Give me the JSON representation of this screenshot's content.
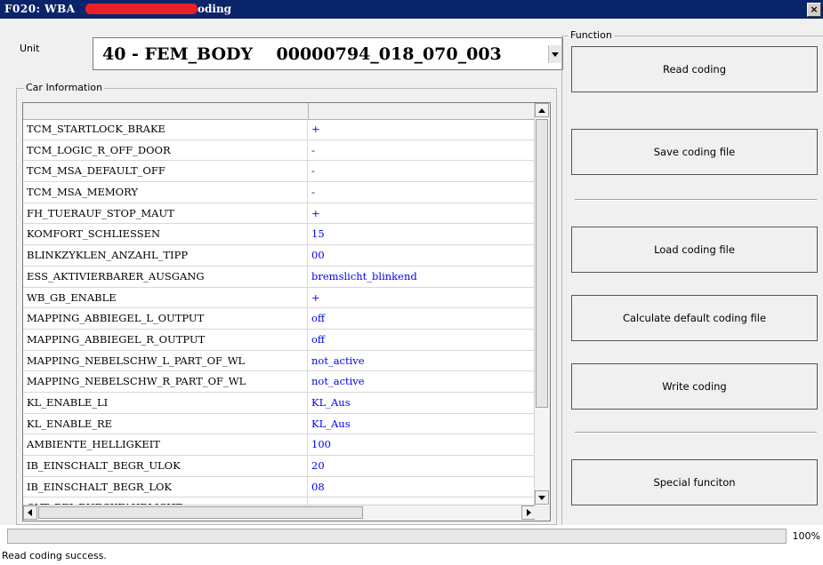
{
  "window": {
    "title_prefix": "F020: WBA",
    "title_suffix": "oding",
    "close_label": "×"
  },
  "unit": {
    "label": "Unit",
    "value": "40 - FEM_BODY    00000794_018_070_003"
  },
  "car_info": {
    "legend": "Car Information",
    "rows": [
      {
        "name": "TCM_STARTLOCK_BRAKE",
        "value": "+"
      },
      {
        "name": "TCM_LOGIC_R_OFF_DOOR",
        "value": "-"
      },
      {
        "name": "TCM_MSA_DEFAULT_OFF",
        "value": "-"
      },
      {
        "name": "TCM_MSA_MEMORY",
        "value": "-"
      },
      {
        "name": "FH_TUERAUF_STOP_MAUT",
        "value": "+"
      },
      {
        "name": "KOMFORT_SCHLIESSEN",
        "value": "15"
      },
      {
        "name": "BLINKZYKLEN_ANZAHL_TIPP",
        "value": "00"
      },
      {
        "name": "ESS_AKTIVIERBARER_AUSGANG",
        "value": "bremslicht_blinkend"
      },
      {
        "name": "WB_GB_ENABLE",
        "value": "+"
      },
      {
        "name": "MAPPING_ABBIEGEL_L_OUTPUT",
        "value": "off"
      },
      {
        "name": "MAPPING_ABBIEGEL_R_OUTPUT",
        "value": "off"
      },
      {
        "name": "MAPPING_NEBELSCHW_L_PART_OF_WL",
        "value": "not_active"
      },
      {
        "name": "MAPPING_NEBELSCHW_R_PART_OF_WL",
        "value": "not_active"
      },
      {
        "name": "KL_ENABLE_LI",
        "value": "KL_Aus"
      },
      {
        "name": "KL_ENABLE_RE",
        "value": "KL_Aus"
      },
      {
        "name": "AMBIENTE_HELLIGKEIT",
        "value": "100"
      },
      {
        "name": "IB_EINSCHALT_BEGR_ULOK",
        "value": "20"
      },
      {
        "name": "IB_EINSCHALT_BEGR_LOK",
        "value": "08"
      },
      {
        "name": "OVT_BEI_RUECKFAHRLICHT",
        "value": "-"
      }
    ]
  },
  "function": {
    "legend": "Function",
    "buttons": {
      "read": "Read coding",
      "save": "Save coding file",
      "load": "Load coding file",
      "calculate": "Calculate default coding file",
      "write": "Write coding",
      "special": "Special funciton"
    }
  },
  "progress": {
    "value": 100,
    "label": "100%"
  },
  "status": {
    "text": "Read coding success."
  },
  "colors": {
    "titlebar": "#0a246a",
    "value_text": "#0000ee",
    "redaction": "#e8202a"
  }
}
